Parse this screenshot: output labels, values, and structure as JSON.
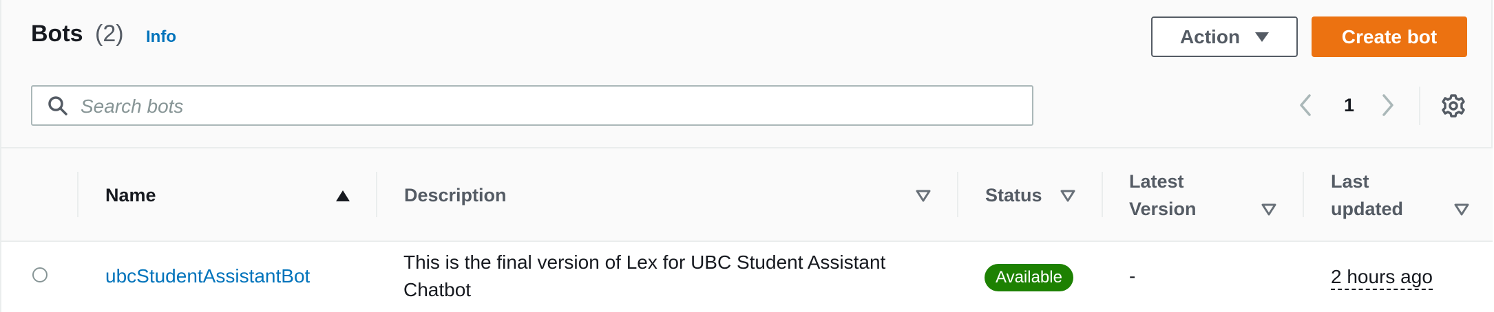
{
  "header": {
    "title": "Bots",
    "count": "(2)",
    "info_link": "Info",
    "action_button": "Action",
    "create_button": "Create bot"
  },
  "search": {
    "placeholder": "Search bots",
    "value": ""
  },
  "pagination": {
    "current_page": "1"
  },
  "table": {
    "columns": [
      {
        "label": "Name",
        "sort": "ascending"
      },
      {
        "label": "Description",
        "sort": "none"
      },
      {
        "label": "Status",
        "sort": "none"
      },
      {
        "label": "Latest Version",
        "sort": "none"
      },
      {
        "label": "Last updated",
        "sort": "none"
      }
    ],
    "rows": [
      {
        "name": "ubcStudentAssistantBot",
        "description": "This is the final version of Lex for UBC Student Assistant Chatbot",
        "status": "Available",
        "latest_version": "-",
        "last_updated": "2 hours ago"
      }
    ]
  },
  "colors": {
    "accent_orange": "#ec7211",
    "link_blue": "#0073bb",
    "status_green": "#1d8102"
  },
  "icons": [
    "search-icon",
    "chevron-left-icon",
    "chevron-right-icon",
    "gear-icon",
    "caret-down-icon",
    "sort-ascending-icon",
    "sort-descending-icon"
  ]
}
